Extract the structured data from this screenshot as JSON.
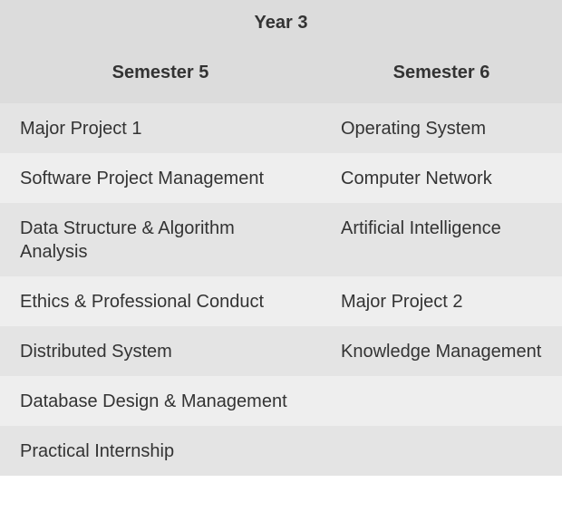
{
  "table": {
    "year_heading": "Year 3",
    "columns": [
      "Semester 5",
      "Semester 6"
    ],
    "rows": [
      [
        "Major Project 1",
        "Operating System"
      ],
      [
        "Software Project Management",
        "Computer Network"
      ],
      [
        "Data Structure & Algorithm Analysis",
        "Artificial Intelligence"
      ],
      [
        "Ethics & Professional Conduct",
        "Major Project 2"
      ],
      [
        "Distributed System",
        "Knowledge Management"
      ],
      [
        "Database Design & Management",
        ""
      ],
      [
        "Practical Internship",
        ""
      ]
    ]
  }
}
